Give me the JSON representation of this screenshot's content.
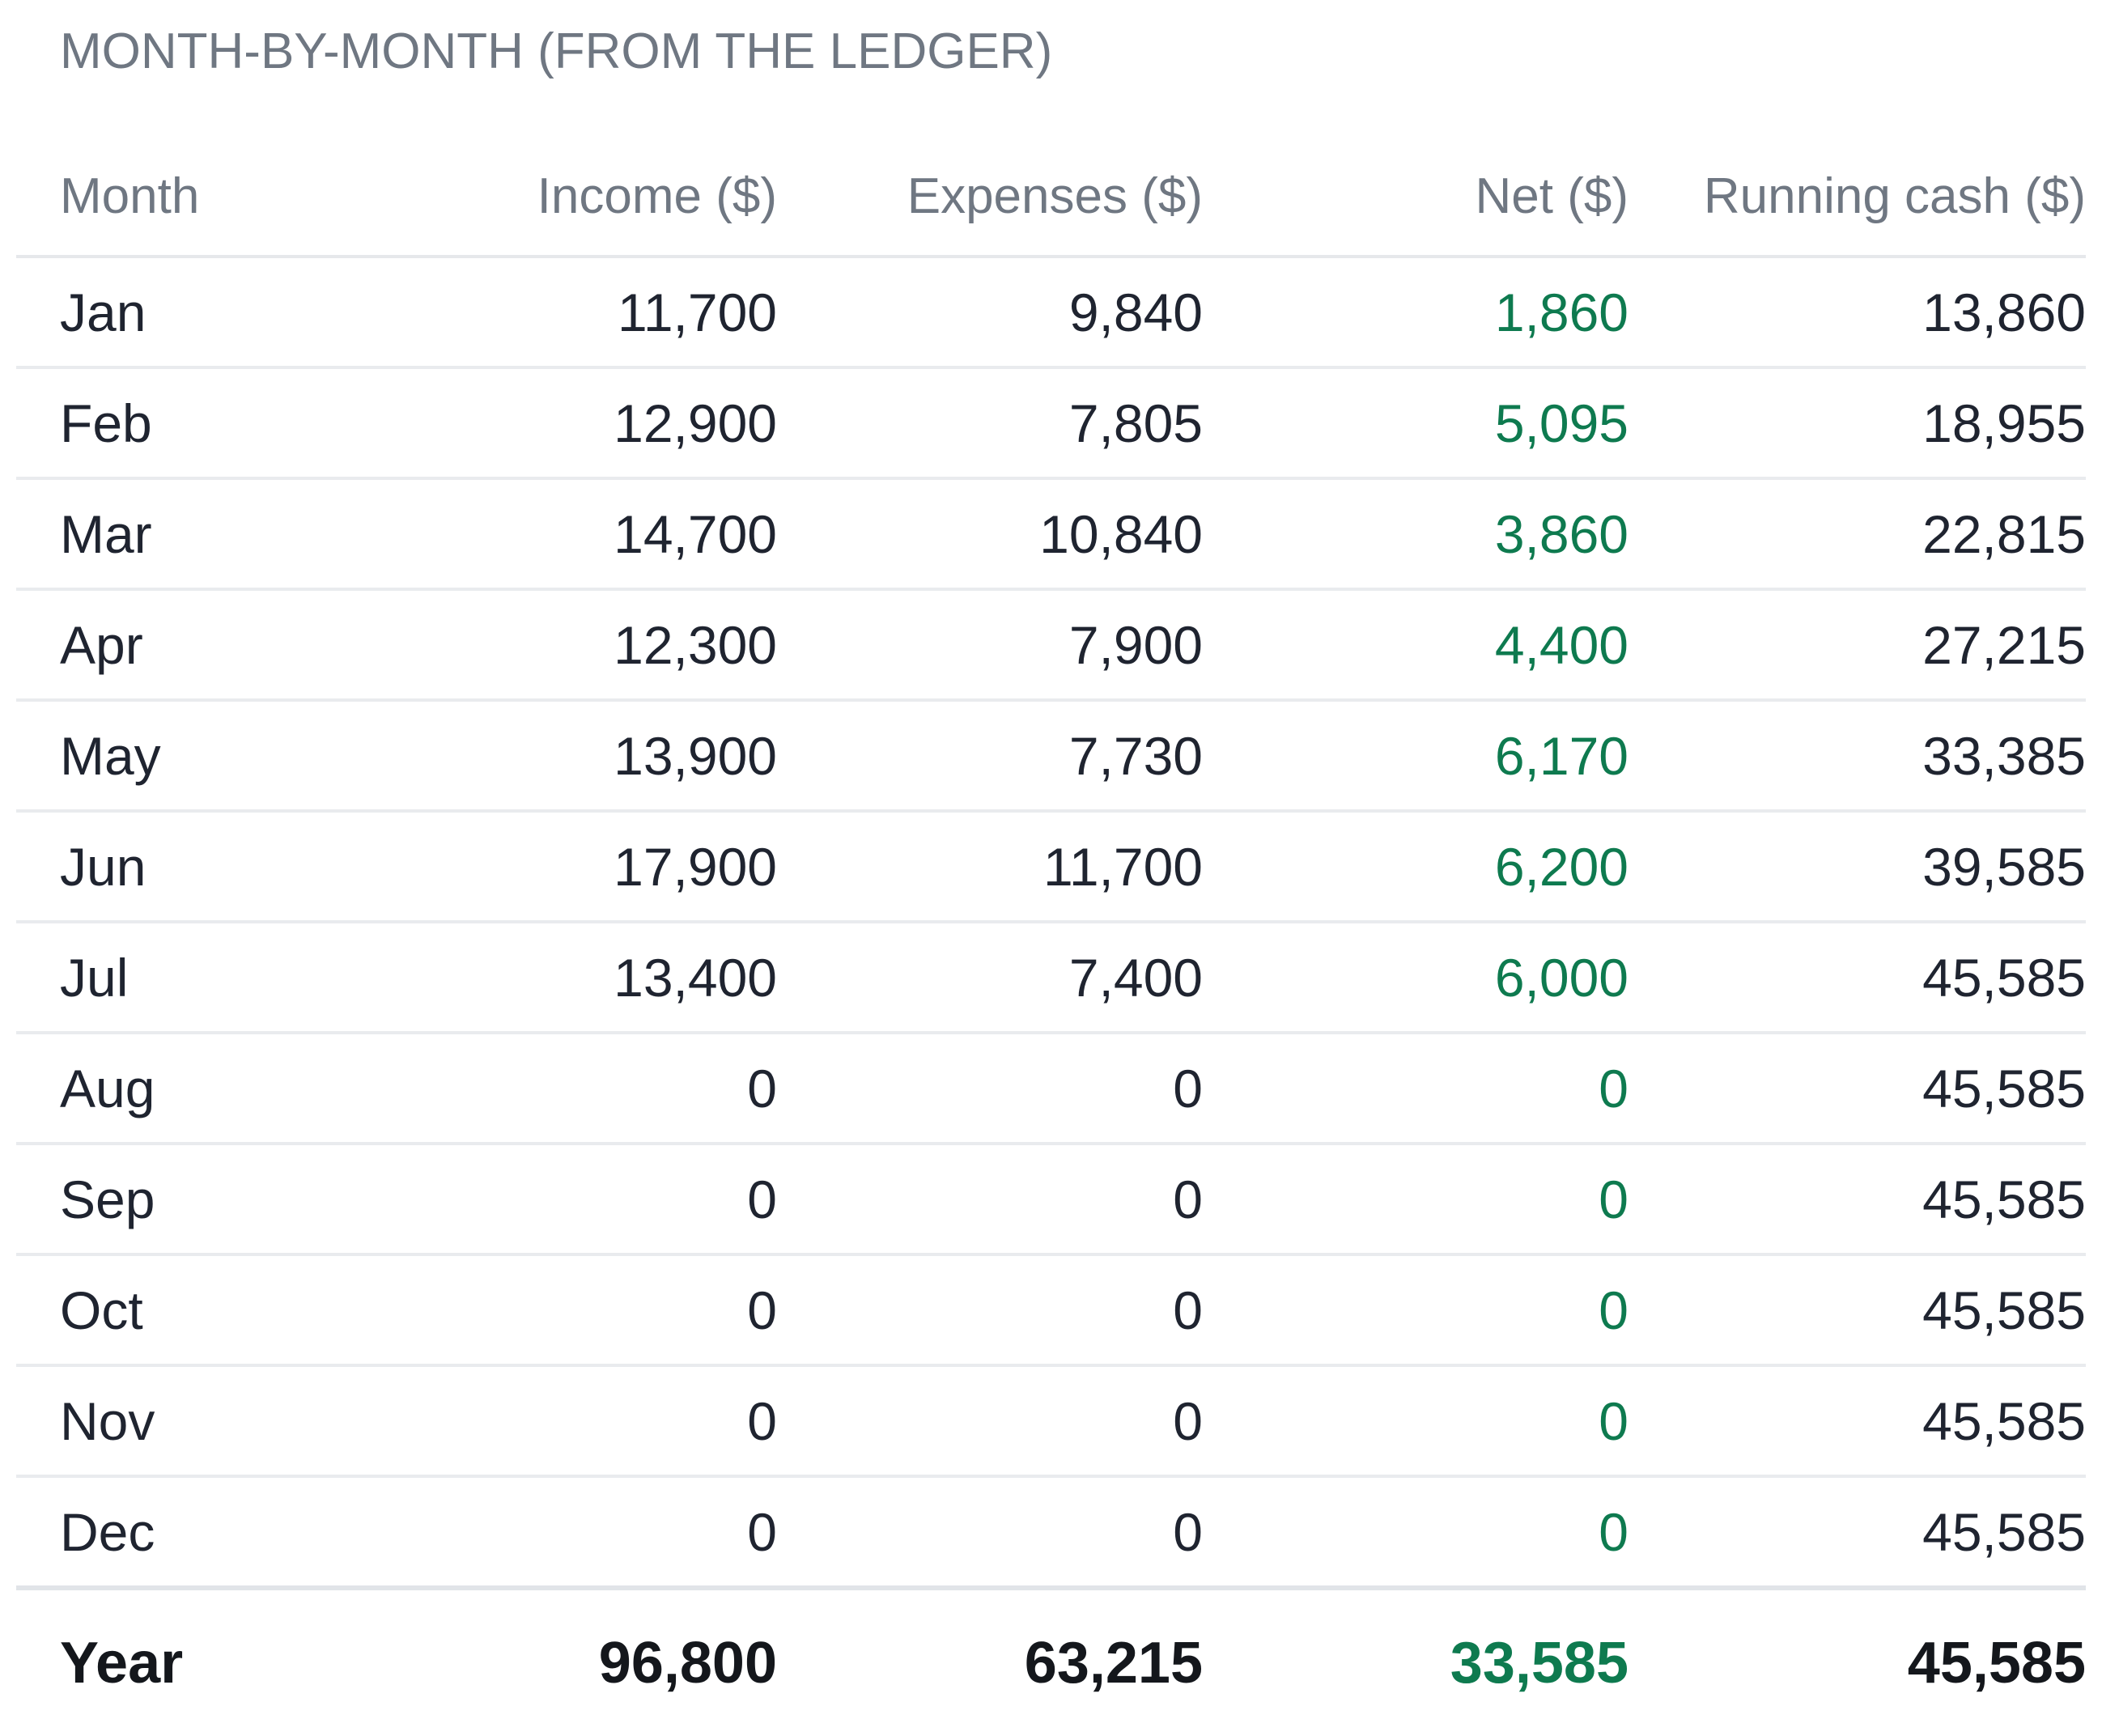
{
  "section_title": "MONTH-BY-MONTH (FROM THE LEDGER)",
  "columns": {
    "month": "Month",
    "income": "Income ($)",
    "expenses": "Expenses ($)",
    "net": "Net ($)",
    "running": "Running cash ($)"
  },
  "rows": [
    {
      "month": "Jan",
      "income": "11,700",
      "expenses": "9,840",
      "net": "1,860",
      "running": "13,860"
    },
    {
      "month": "Feb",
      "income": "12,900",
      "expenses": "7,805",
      "net": "5,095",
      "running": "18,955"
    },
    {
      "month": "Mar",
      "income": "14,700",
      "expenses": "10,840",
      "net": "3,860",
      "running": "22,815"
    },
    {
      "month": "Apr",
      "income": "12,300",
      "expenses": "7,900",
      "net": "4,400",
      "running": "27,215"
    },
    {
      "month": "May",
      "income": "13,900",
      "expenses": "7,730",
      "net": "6,170",
      "running": "33,385"
    },
    {
      "month": "Jun",
      "income": "17,900",
      "expenses": "11,700",
      "net": "6,200",
      "running": "39,585"
    },
    {
      "month": "Jul",
      "income": "13,400",
      "expenses": "7,400",
      "net": "6,000",
      "running": "45,585"
    },
    {
      "month": "Aug",
      "income": "0",
      "expenses": "0",
      "net": "0",
      "running": "45,585"
    },
    {
      "month": "Sep",
      "income": "0",
      "expenses": "0",
      "net": "0",
      "running": "45,585"
    },
    {
      "month": "Oct",
      "income": "0",
      "expenses": "0",
      "net": "0",
      "running": "45,585"
    },
    {
      "month": "Nov",
      "income": "0",
      "expenses": "0",
      "net": "0",
      "running": "45,585"
    },
    {
      "month": "Dec",
      "income": "0",
      "expenses": "0",
      "net": "0",
      "running": "45,585"
    }
  ],
  "total": {
    "month": "Year",
    "income": "96,800",
    "expenses": "63,215",
    "net": "33,585",
    "running": "45,585"
  },
  "colors": {
    "net_positive": "#0e7a4f",
    "header_text": "#6f7782",
    "body_text": "#1f2430",
    "divider": "#e9ebee"
  }
}
